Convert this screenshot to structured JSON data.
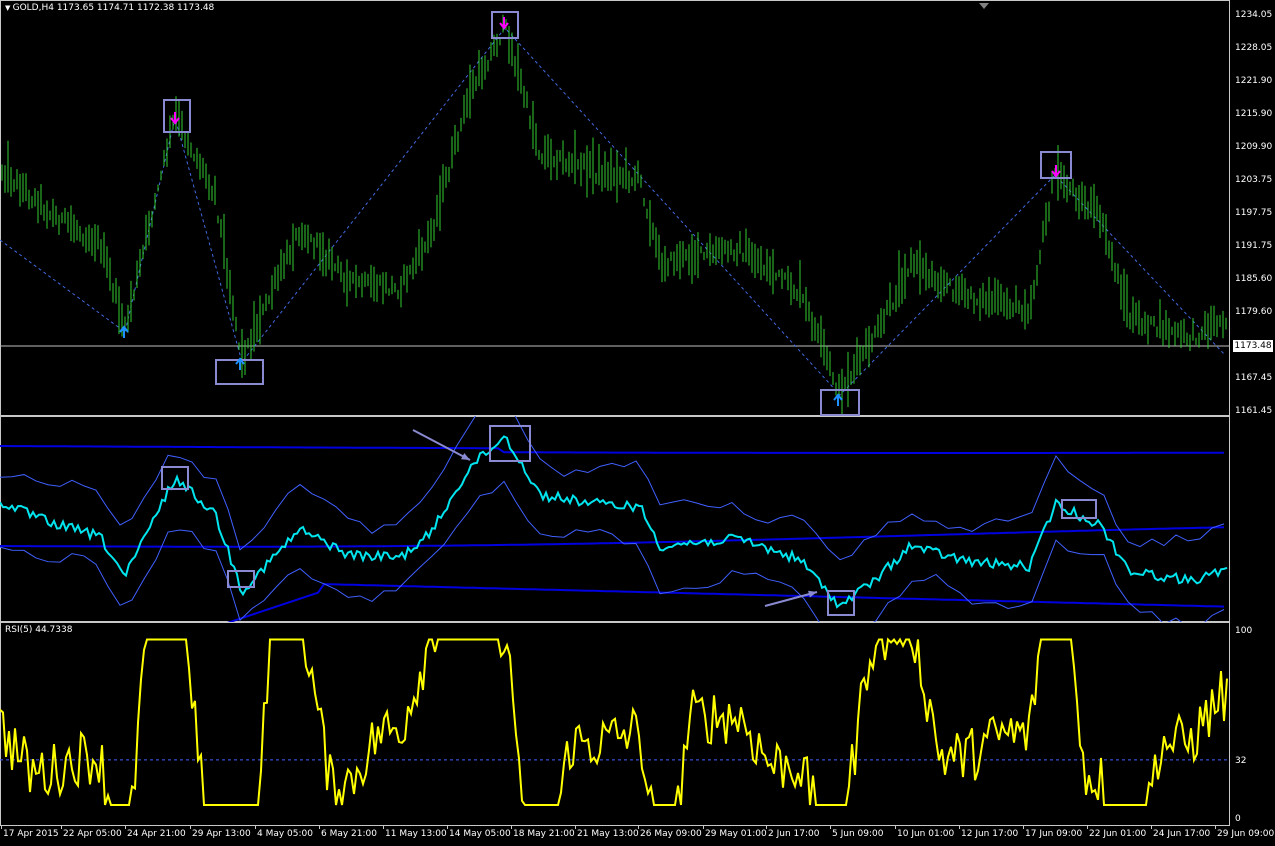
{
  "main_chart": {
    "title": "GOLD,H4  1173.65 1174.71 1172.38 1173.48",
    "current_price": "1173.48",
    "price_ticks": [
      "1234.05",
      "1228.05",
      "1221.90",
      "1215.90",
      "1209.90",
      "1203.75",
      "1197.75",
      "1191.75",
      "1185.60",
      "1179.60",
      "1173.45",
      "1167.45",
      "1161.45"
    ],
    "colors": {
      "candles": "#32cd32",
      "zigzag": "#4169e1",
      "up_arrow": "#1e90ff",
      "down_arrow": "#ff00ff",
      "highlight_box": "#8a8ad2",
      "price_line": "#c0c0c0"
    }
  },
  "bands_pane": {
    "colors": {
      "line": "#00e5ee",
      "bands": "#4060ff",
      "slow_bands": "#0000e0",
      "arrow": "#8a8ad2"
    }
  },
  "rsi_pane": {
    "title": "RSI(5) 44.7338",
    "scale_ticks": [
      "100",
      "32",
      "0"
    ],
    "level": 32,
    "color": "#ffff00"
  },
  "time_axis": {
    "labels": [
      "17 Apr 2015",
      "22 Apr 05:00",
      "24 Apr 21:00",
      "29 Apr 13:00",
      "4 May 05:00",
      "6 May 21:00",
      "11 May 13:00",
      "14 May 05:00",
      "18 May 21:00",
      "21 May 13:00",
      "26 May 09:00",
      "29 May 01:00",
      "2 Jun 17:00",
      "5 Jun 09:00",
      "10 Jun 01:00",
      "12 Jun 17:00",
      "17 Jun 09:00",
      "22 Jun 01:00",
      "24 Jun 17:00",
      "29 Jun 09:00"
    ]
  }
}
